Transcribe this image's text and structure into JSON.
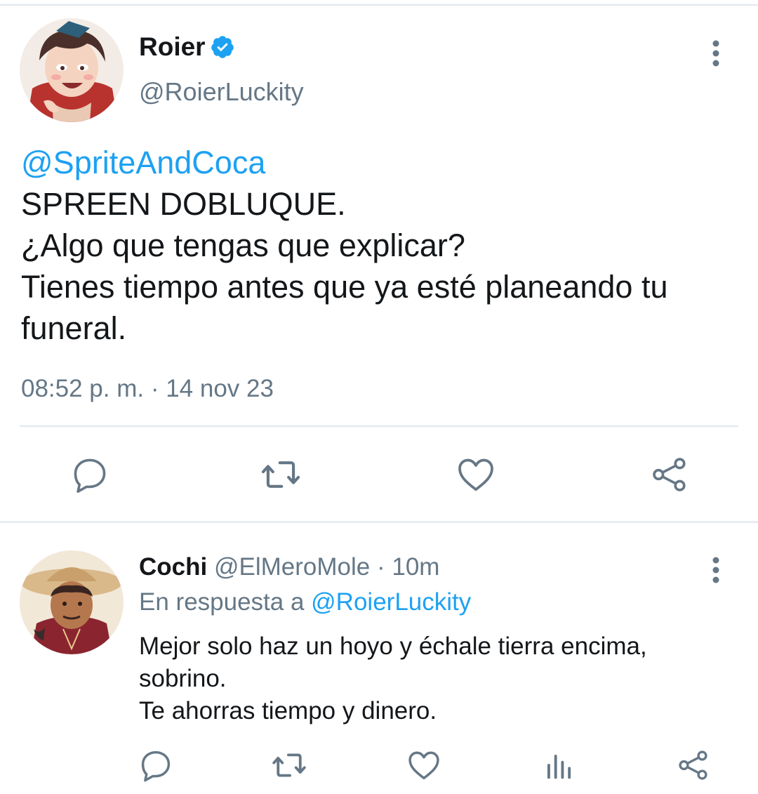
{
  "colors": {
    "link": "#1da1f2",
    "secondary_text": "#657786",
    "primary_text": "#14171a",
    "divider": "#e1e8ed"
  },
  "main_tweet": {
    "display_name": "Roier",
    "handle": "@RoierLuckity",
    "mention": "@SpriteAndCoca",
    "lines": [
      "SPREEN DOBLUQUE.",
      "¿Algo que tengas que explicar?",
      "Tienes tiempo antes que ya esté planeando tu",
      "funeral."
    ],
    "timestamp": "08:52 p. m. · 14 nov 23",
    "icons": [
      "verified-badge-icon",
      "more-vertical-icon",
      "reply-icon",
      "retweet-icon",
      "like-icon",
      "share-icon"
    ]
  },
  "reply_tweet": {
    "display_name": "Cochi",
    "handle": "@ElMeroMole",
    "time": "· 10m",
    "in_reply_prefix": "En respuesta a ",
    "in_reply_mention": "@RoierLuckity",
    "lines": [
      "Mejor solo haz un hoyo y échale tierra encima,",
      "sobrino.",
      "Te ahorras tiempo y dinero."
    ],
    "icons": [
      "more-vertical-icon",
      "reply-icon",
      "retweet-icon",
      "like-icon",
      "analytics-icon",
      "share-icon"
    ]
  }
}
